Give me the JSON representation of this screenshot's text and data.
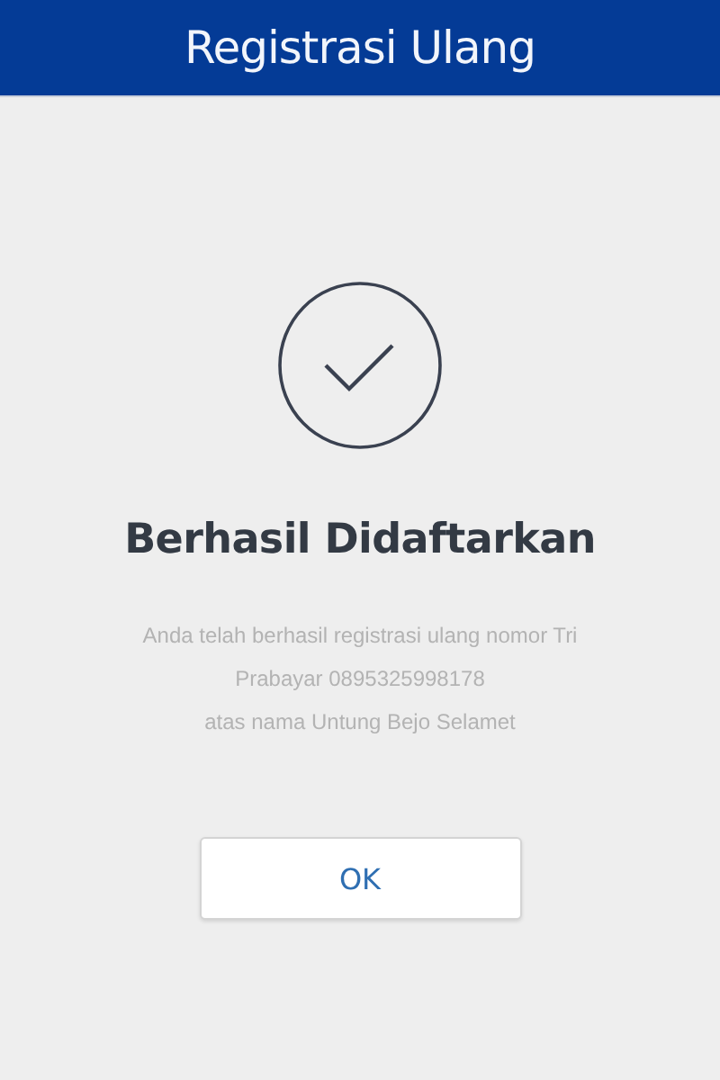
{
  "header": {
    "title": "Registrasi Ulang"
  },
  "result": {
    "title": "Berhasil Didaftarkan",
    "message_lines": [
      "Anda telah berhasil registrasi ulang nomor Tri",
      "Prabayar 0895325998178",
      "atas nama Untung Bejo Selamet"
    ]
  },
  "button": {
    "label": "OK"
  }
}
